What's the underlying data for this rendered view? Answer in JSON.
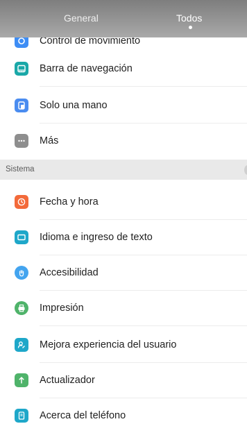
{
  "tabs": {
    "general_label": "General",
    "todos_label": "Todos"
  },
  "items_top": [
    {
      "label": "Control de movimiento",
      "icon": "motion-icon",
      "color": "#3d8df5"
    },
    {
      "label": "Barra de navegación",
      "icon": "navigation-bar-icon",
      "color": "#1aa8a8"
    },
    {
      "label": "Solo una mano",
      "icon": "one-hand-icon",
      "color": "#4a8cf0"
    },
    {
      "label": "Más",
      "icon": "more-icon",
      "color": "#8e8e8e"
    }
  ],
  "section": {
    "title": "Sistema"
  },
  "items_system": [
    {
      "label": "Fecha y hora",
      "icon": "clock-icon",
      "color": "#f36a3a"
    },
    {
      "label": "Idioma e ingreso de texto",
      "icon": "keyboard-icon",
      "color": "#1ea7c9"
    },
    {
      "label": "Accesibilidad",
      "icon": "hand-icon",
      "color": "#43a4ef"
    },
    {
      "label": "Impresión",
      "icon": "printer-icon",
      "color": "#4fb36a"
    },
    {
      "label": "Mejora experiencia del usuario",
      "icon": "user-experience-icon",
      "color": "#1ea7c9"
    },
    {
      "label": "Actualizador",
      "icon": "arrow-up-icon",
      "color": "#4fb36a"
    },
    {
      "label": "Acerca del teléfono",
      "icon": "phone-info-icon",
      "color": "#1ea7c9"
    }
  ]
}
